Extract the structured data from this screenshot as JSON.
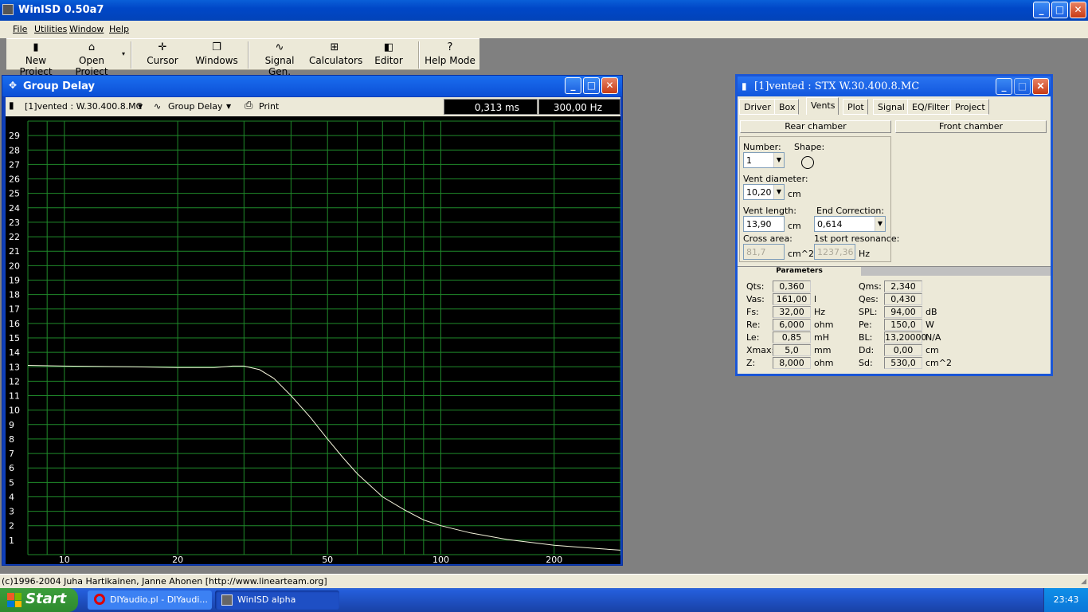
{
  "app": {
    "title": "WinISD 0.50a7"
  },
  "menu": [
    "File",
    "Utilities",
    "Window",
    "Help"
  ],
  "toolbar": {
    "buttons": [
      {
        "label": "New Project",
        "icon": "new-project-icon"
      },
      {
        "label": "Open Project",
        "icon": "open-project-icon"
      },
      {
        "label": "Cursor",
        "icon": "cursor-icon"
      },
      {
        "label": "Windows",
        "icon": "windows-icon"
      },
      {
        "label": "Signal Gen.",
        "icon": "signal-generator-icon"
      },
      {
        "label": "Calculators",
        "icon": "calculators-icon"
      },
      {
        "label": "Editor",
        "icon": "editor-icon"
      },
      {
        "label": "Help Mode",
        "icon": "help-icon"
      }
    ]
  },
  "group_delay": {
    "title": "Group Delay",
    "project_select": "[1]vented : W.30.400.8.MC",
    "plot_select": "Group Delay",
    "print_label": "Print",
    "readout_ms": "0,313 ms",
    "readout_hz": "300,00 Hz"
  },
  "chart_data": {
    "type": "line",
    "title": "",
    "xlabel": "",
    "ylabel": "",
    "x_scale": "log",
    "xlim": [
      8,
      300
    ],
    "ylim": [
      0,
      30
    ],
    "x_ticks": [
      "10",
      "20",
      "50",
      "100",
      "200"
    ],
    "y_ticks": [
      "1",
      "2",
      "3",
      "4",
      "5",
      "6",
      "7",
      "8",
      "9",
      "10",
      "11",
      "12",
      "13",
      "14",
      "15",
      "16",
      "17",
      "18",
      "19",
      "20",
      "21",
      "22",
      "23",
      "24",
      "25",
      "26",
      "27",
      "28",
      "29"
    ],
    "grid": true,
    "colors": {
      "background": "#000000",
      "grid": "#1f8a2a",
      "curve": "#f5f5dc",
      "tick_text": "#ffffff"
    },
    "series": [
      {
        "x": [
          8,
          10,
          15,
          20,
          25,
          28,
          30,
          33,
          36,
          40,
          45,
          50,
          55,
          60,
          70,
          80,
          90,
          100,
          120,
          150,
          200,
          250,
          300
        ],
        "y": [
          13.1,
          13.05,
          13.0,
          12.95,
          12.95,
          13.05,
          13.05,
          12.8,
          12.2,
          11.0,
          9.5,
          8.0,
          6.7,
          5.6,
          4.0,
          3.1,
          2.4,
          2.0,
          1.5,
          1.05,
          0.65,
          0.45,
          0.31
        ]
      }
    ]
  },
  "vents_window": {
    "title": "[1]vented : STX W.30.400.8.MC",
    "tabs": [
      "Driver",
      "Box",
      "Vents",
      "Plot",
      "Signal",
      "EQ/Filter",
      "Project"
    ],
    "active_tab": "Vents",
    "rear_chamber": "Rear chamber",
    "front_chamber": "Front chamber",
    "number_label": "Number:",
    "number_value": "1",
    "shape_label": "Shape:",
    "vent_diameter_label": "Vent diameter:",
    "vent_diameter_value": "10,20",
    "vent_diameter_unit": "cm",
    "vent_length_label": "Vent length:",
    "vent_length_value": "13,90",
    "vent_length_unit": "cm",
    "end_correction_label": "End Correction:",
    "end_correction_value": "0,614",
    "cross_area_label": "Cross area:",
    "cross_area_value": "81,7",
    "cross_area_unit": "cm^2",
    "port_resonance_label": "1st port resonance:",
    "port_resonance_value": "1237,36",
    "port_resonance_unit": "Hz",
    "parameters_header": "Parameters",
    "params_left": [
      {
        "name": "Qts:",
        "value": "0,360",
        "unit": ""
      },
      {
        "name": "Vas:",
        "value": "161,00",
        "unit": "l"
      },
      {
        "name": "Fs:",
        "value": "32,00",
        "unit": "Hz"
      },
      {
        "name": "Re:",
        "value": "6,000",
        "unit": "ohm"
      },
      {
        "name": "Le:",
        "value": "0,85",
        "unit": "mH"
      },
      {
        "name": "Xmax:",
        "value": "5,0",
        "unit": "mm"
      },
      {
        "name": "Z:",
        "value": "8,000",
        "unit": "ohm"
      }
    ],
    "params_right": [
      {
        "name": "Qms:",
        "value": "2,340",
        "unit": ""
      },
      {
        "name": "Qes:",
        "value": "0,430",
        "unit": ""
      },
      {
        "name": "SPL:",
        "value": "94,00",
        "unit": "dB"
      },
      {
        "name": "Pe:",
        "value": "150,0",
        "unit": "W"
      },
      {
        "name": "BL:",
        "value": "13,20000",
        "unit": "N/A"
      },
      {
        "name": "Dd:",
        "value": "0,00",
        "unit": "cm"
      },
      {
        "name": "Sd:",
        "value": "530,0",
        "unit": "cm^2"
      }
    ]
  },
  "status": "(c)1996-2004 Juha Hartikainen, Janne Ahonen [http://www.linearteam.org]",
  "taskbar": {
    "start_label": "Start",
    "tasks": [
      "DIYaudio.pl - DIYaudi...",
      "WinISD alpha"
    ],
    "clock": "23:43"
  }
}
